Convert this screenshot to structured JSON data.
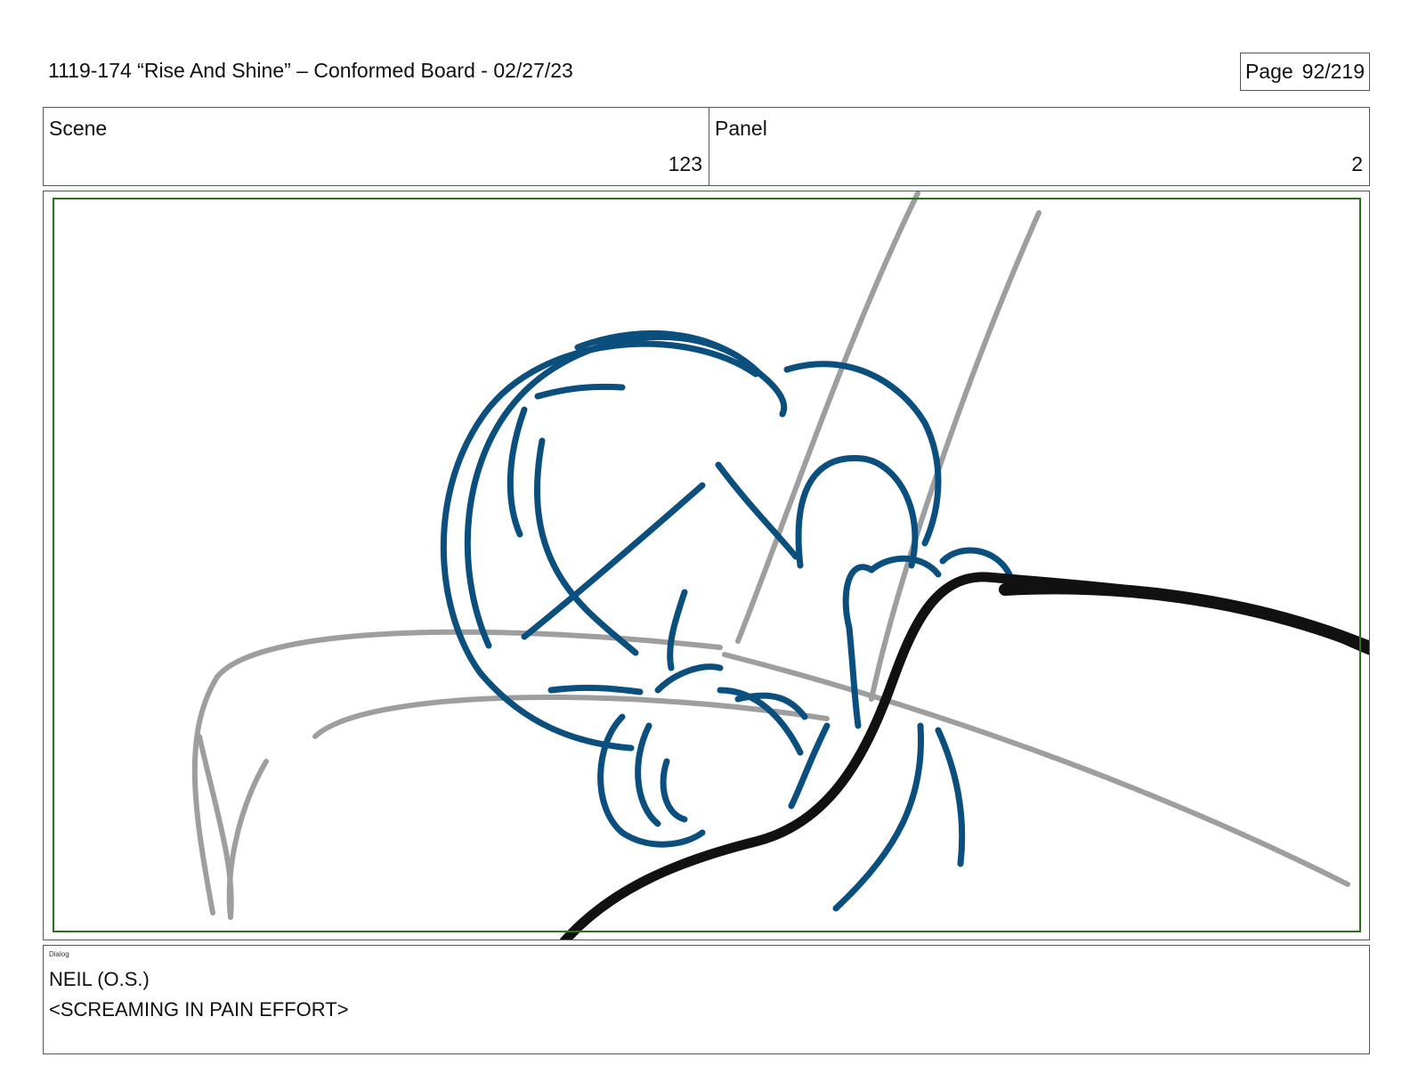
{
  "header": {
    "title": "1119-174 “Rise And Shine” – Conformed Board - 02/27/23",
    "page_label": "Page",
    "page_value": "92/219"
  },
  "info": {
    "scene_label": "Scene",
    "scene_value": "123",
    "panel_label": "Panel",
    "panel_value": "2"
  },
  "panel": {
    "colors": {
      "character": "#0b4f7e",
      "layout": "#9e9e9e",
      "foreground": "#111111",
      "safe_frame": "#2e6e1f"
    }
  },
  "dialog": {
    "label": "Dialog",
    "speaker": "NEIL (O.S.)",
    "line": "<SCREAMING IN PAIN EFFORT>"
  }
}
